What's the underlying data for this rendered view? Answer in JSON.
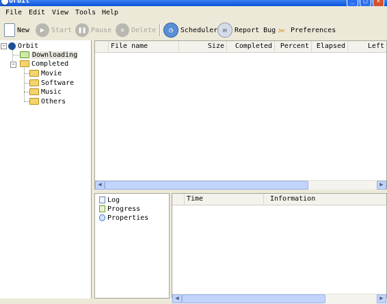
{
  "window": {
    "title": "Orbit"
  },
  "menu": [
    "File",
    "Edit",
    "View",
    "Tools",
    "Help"
  ],
  "toolbar": {
    "new": "New",
    "start": "Start",
    "pause": "Pause",
    "delete": "Delete",
    "scheduler": "Scheduler",
    "report_bug": "Report Bug",
    "preferences": "Preferences"
  },
  "tree": {
    "root": "Orbit",
    "downloading": "Downloading",
    "completed": "Completed",
    "children": [
      "Movie",
      "Software",
      "Music",
      "Others"
    ]
  },
  "file_list": {
    "columns": [
      "File name",
      "Size",
      "Completed",
      "Percent",
      "Elapsed",
      "Left"
    ]
  },
  "info_tabs": [
    "Log",
    "Progress",
    "Properties"
  ],
  "log": {
    "columns": [
      "Time",
      "Information"
    ]
  },
  "colors": {
    "title_bar": "#0a52d8",
    "scroll_thumb": "#c2d3fc",
    "folder": "#f3d56b"
  }
}
